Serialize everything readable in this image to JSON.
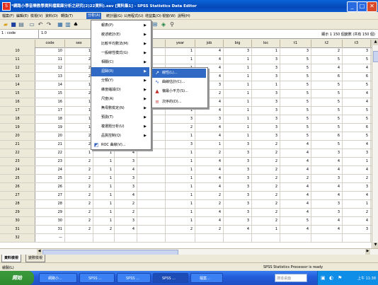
{
  "window": {
    "title": "*網路小學音樂教學資料檔案庫分析之研究(2)22資料).sav [資料集1] - SPSS Statistics Data Editor",
    "app_icon": "spss-app-icon"
  },
  "menubar": [
    {
      "label": "檔案(F)"
    },
    {
      "label": "編輯(E)"
    },
    {
      "label": "檢視(V)"
    },
    {
      "label": "資料(D)"
    },
    {
      "label": "轉換(T)"
    },
    {
      "label": "分析(A)"
    },
    {
      "label": "統計圖(G)"
    },
    {
      "label": "公用程式(U)"
    },
    {
      "label": "增益集(O)"
    },
    {
      "label": "視窗(W)"
    },
    {
      "label": "說明(H)"
    }
  ],
  "refbar": {
    "cell": "1 : code",
    "value": "1.0",
    "varcount": "顯示 1 150 個變數 (共有 150 個)"
  },
  "columns": [
    "code",
    "sex",
    "",
    "",
    "",
    "year",
    "job",
    "big",
    "loc",
    "t1",
    "t2",
    "t3"
  ],
  "rows": [
    {
      "n": "10",
      "v": [
        "10",
        "1",
        "",
        "",
        "",
        "1",
        "4",
        "3",
        "1",
        "3",
        "2",
        "3"
      ]
    },
    {
      "n": "11",
      "v": [
        "11",
        "2",
        "",
        "",
        "",
        "1",
        "4",
        "1",
        "3",
        "5",
        "5",
        "5"
      ]
    },
    {
      "n": "12",
      "v": [
        "12",
        "2",
        "",
        "",
        "",
        "1",
        "4",
        "1",
        "3",
        "5",
        "4",
        "4"
      ]
    },
    {
      "n": "13",
      "v": [
        "13",
        "2",
        "",
        "",
        "",
        "1",
        "4",
        "1",
        "3",
        "5",
        "6",
        "6"
      ]
    },
    {
      "n": "14",
      "v": [
        "14",
        "1",
        "",
        "",
        "",
        "1",
        "3",
        "1",
        "1",
        "5",
        "5",
        "5"
      ]
    },
    {
      "n": "15",
      "v": [
        "15",
        "2",
        "",
        "",
        "",
        "1",
        "2",
        "1",
        "3",
        "5",
        "5",
        "4"
      ]
    },
    {
      "n": "16",
      "v": [
        "16",
        "1",
        "",
        "",
        "",
        "1",
        "4",
        "1",
        "3",
        "5",
        "5",
        "4"
      ]
    },
    {
      "n": "17",
      "v": [
        "17",
        "1",
        "",
        "",
        "",
        "1",
        "4",
        "1",
        "3",
        "5",
        "5",
        "5"
      ]
    },
    {
      "n": "18",
      "v": [
        "18",
        "1",
        "",
        "",
        "",
        "3",
        "3",
        "1",
        "3",
        "5",
        "5",
        "5"
      ]
    },
    {
      "n": "19",
      "v": [
        "19",
        "1",
        "",
        "",
        "",
        "2",
        "4",
        "1",
        "3",
        "5",
        "5",
        "6"
      ]
    },
    {
      "n": "20",
      "v": [
        "20",
        "2",
        "",
        "",
        "",
        "1",
        "4",
        "1",
        "3",
        "5",
        "6",
        "5"
      ]
    },
    {
      "n": "21",
      "v": [
        "21",
        "2",
        "3",
        "5",
        "",
        "3",
        "1",
        "3",
        "2",
        "4",
        "5",
        "4"
      ]
    },
    {
      "n": "22",
      "v": [
        "22",
        "1",
        "1",
        "4",
        "",
        "1",
        "2",
        "3",
        "2",
        "4",
        "3",
        "3"
      ]
    },
    {
      "n": "23",
      "v": [
        "23",
        "2",
        "1",
        "3",
        "",
        "1",
        "4",
        "3",
        "2",
        "4",
        "4",
        "1"
      ]
    },
    {
      "n": "24",
      "v": [
        "24",
        "2",
        "1",
        "4",
        "",
        "1",
        "4",
        "3",
        "2",
        "4",
        "4",
        "4"
      ]
    },
    {
      "n": "25",
      "v": [
        "25",
        "2",
        "1",
        "3",
        "",
        "1",
        "4",
        "3",
        "2",
        "2",
        "3",
        "2"
      ]
    },
    {
      "n": "26",
      "v": [
        "26",
        "2",
        "1",
        "3",
        "",
        "1",
        "4",
        "3",
        "2",
        "4",
        "4",
        "3"
      ]
    },
    {
      "n": "27",
      "v": [
        "27",
        "2",
        "1",
        "4",
        "",
        "1",
        "2",
        "3",
        "2",
        "4",
        "4",
        "4"
      ]
    },
    {
      "n": "28",
      "v": [
        "28",
        "2",
        "1",
        "2",
        "",
        "1",
        "2",
        "3",
        "2",
        "4",
        "3",
        "1"
      ]
    },
    {
      "n": "29",
      "v": [
        "29",
        "2",
        "1",
        "2",
        "",
        "1",
        "4",
        "3",
        "2",
        "4",
        "3",
        "2"
      ]
    },
    {
      "n": "30",
      "v": [
        "30",
        "2",
        "1",
        "3",
        "",
        "1",
        "4",
        "3",
        "2",
        "5",
        "4",
        "4"
      ]
    },
    {
      "n": "31",
      "v": [
        "31",
        "2",
        "2",
        "4",
        "",
        "2",
        "2",
        "4",
        "1",
        "4",
        "4",
        "3"
      ]
    },
    {
      "n": "32",
      "v": [
        "—",
        "",
        "",
        "",
        "",
        "",
        "",
        "",
        "",
        "",
        "",
        ""
      ]
    }
  ],
  "analyze_menu": [
    {
      "label": "報表(P)",
      "arrow": true
    },
    {
      "label": "敘述統計(E)",
      "arrow": true
    },
    {
      "label": "比較平均數法(M)",
      "arrow": true
    },
    {
      "label": "一般線性模式(G)",
      "arrow": true
    },
    {
      "label": "相關(C)",
      "arrow": true
    },
    {
      "label": "迴歸(R)",
      "arrow": true,
      "selected": true
    },
    {
      "label": "分類(Y)",
      "arrow": true
    },
    {
      "label": "維度縮減(D)",
      "arrow": true
    },
    {
      "label": "尺度(A)",
      "arrow": true
    },
    {
      "label": "無母數檢定(N)",
      "arrow": true
    },
    {
      "label": "預測(T)",
      "arrow": true
    },
    {
      "label": "複選題分析(U)",
      "arrow": true
    },
    {
      "label": "品質控制(Q)",
      "arrow": true
    },
    {
      "label": "ROC 曲線(V)...",
      "arrow": false
    }
  ],
  "regression_submenu": [
    {
      "label": "線性(L)...",
      "icon": "linear-regression-icon",
      "selected": true
    },
    {
      "label": "曲線估計(C)...",
      "icon": "curve-estimation-icon"
    },
    {
      "label": "偏最小平方(S)...",
      "icon": "partial-least-squares-icon"
    },
    {
      "label": "次序的(D)...",
      "icon": "ordinal-regression-icon"
    }
  ],
  "tabs": [
    {
      "label": "資料檢視",
      "active": true
    },
    {
      "label": "變數檢視",
      "active": false
    }
  ],
  "status": {
    "left": "繪製(L)",
    "right": "SPSS Statistics  Processor is ready"
  },
  "taskbar": {
    "start": "開始",
    "tasks": [
      "網路小...",
      "SPSS ...",
      "SPSS ...",
      "SPSS ...",
      "檔案..."
    ],
    "search": "搜尋桌面",
    "clock": "上午 11:38"
  },
  "colors": {
    "titlebar": "#0548b8",
    "selection": "#316ac5"
  }
}
